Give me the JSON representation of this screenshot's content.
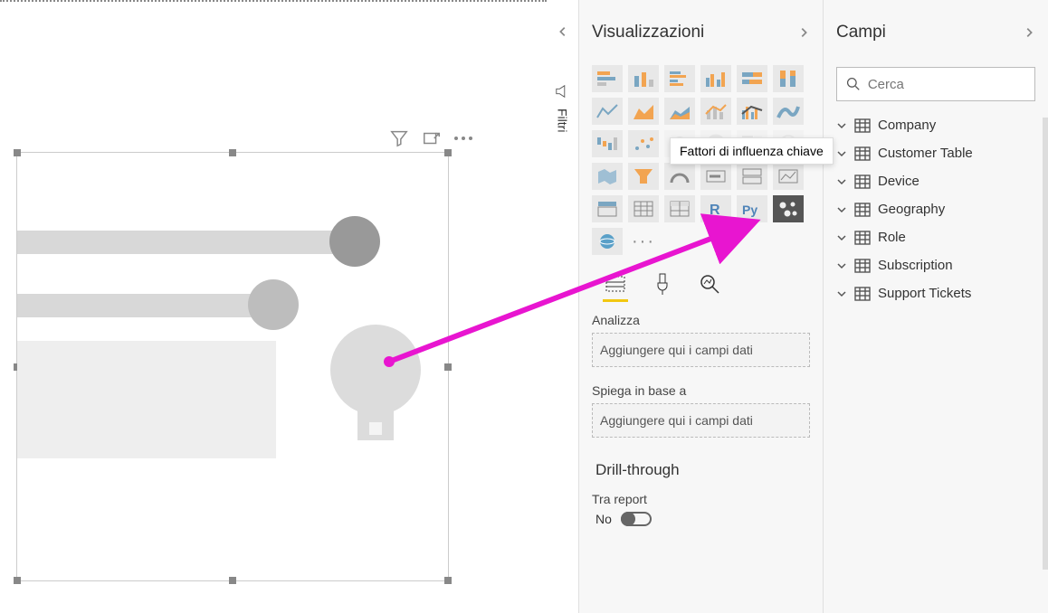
{
  "filters": {
    "label": "Filtri"
  },
  "visualizations": {
    "title": "Visualizzazioni",
    "tooltip": "Fattori di influenza chiave",
    "wells": {
      "analyze_label": "Analizza",
      "analyze_placeholder": "Aggiungere qui i campi dati",
      "explain_label": "Spiega in base a",
      "explain_placeholder": "Aggiungere qui i campi dati"
    },
    "drill": {
      "header": "Drill-through",
      "cross_report_label": "Tra report",
      "cross_report_value": "No"
    }
  },
  "fields": {
    "title": "Campi",
    "search_placeholder": "Cerca",
    "tables": [
      {
        "name": "Company"
      },
      {
        "name": "Customer Table"
      },
      {
        "name": "Device"
      },
      {
        "name": "Geography"
      },
      {
        "name": "Role"
      },
      {
        "name": "Subscription"
      },
      {
        "name": "Support Tickets"
      }
    ]
  }
}
